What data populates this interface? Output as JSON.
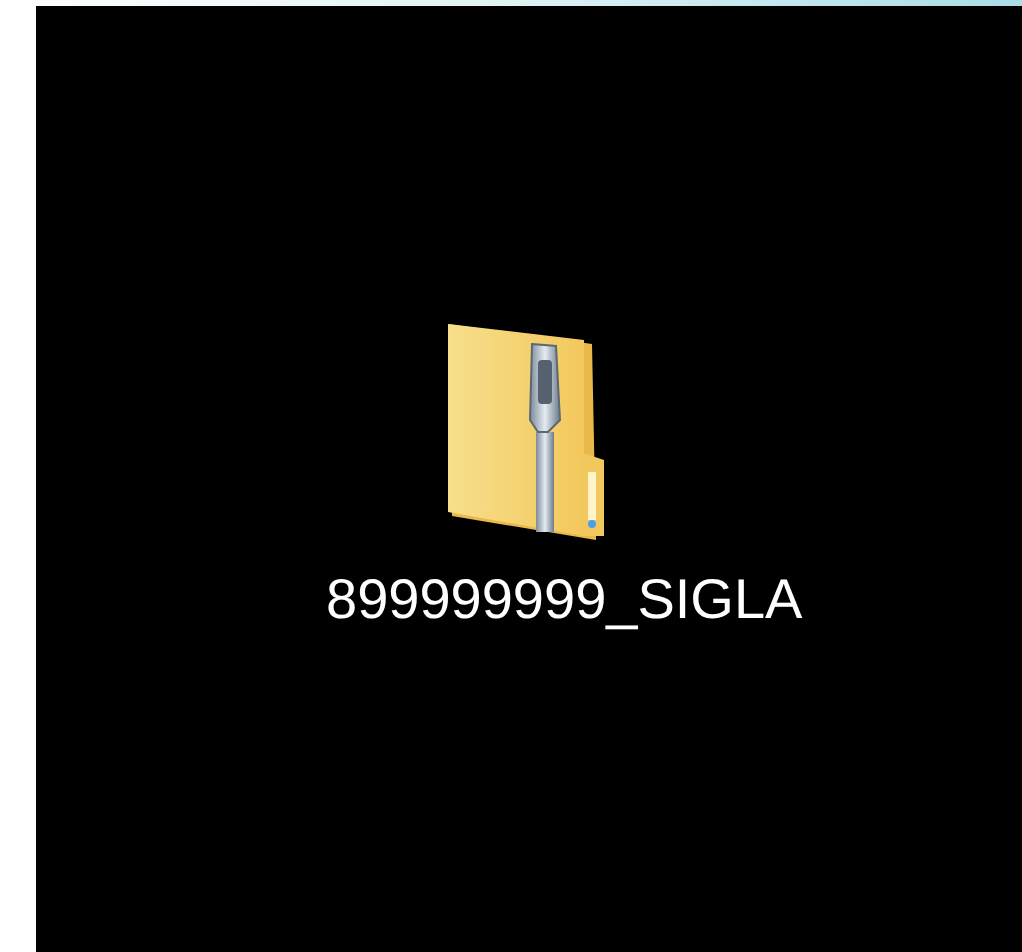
{
  "desktop_items": [
    {
      "kind": "zip",
      "label": "899999999_SIGLA"
    }
  ]
}
